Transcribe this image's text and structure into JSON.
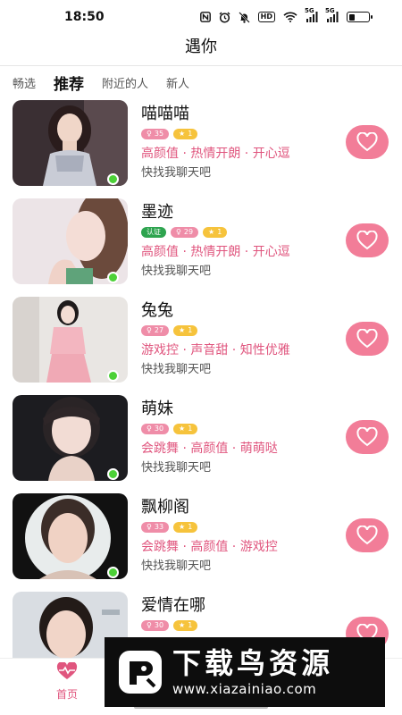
{
  "status_bar": {
    "time": "18:50",
    "icons": [
      "nfc-icon",
      "alarm-icon",
      "mute-icon",
      "hd-icon",
      "wifi-icon",
      "signal-5g-icon",
      "signal-5g-icon",
      "battery-icon"
    ],
    "hd_label": "HD",
    "sig1_label": "5G",
    "sig2_label": "5G"
  },
  "header": {
    "title": "遇你"
  },
  "tabs": [
    {
      "label": "畅选",
      "active": false
    },
    {
      "label": "推荐",
      "active": true
    },
    {
      "label": "附近的人",
      "active": false
    },
    {
      "label": "新人",
      "active": false
    }
  ],
  "users": [
    {
      "name": "喵喵喵",
      "verified": false,
      "age": "35",
      "level": "1",
      "tags": "高颜值 · 热情开朗 · 开心逗",
      "intro": "快找我聊天吧",
      "online": true
    },
    {
      "name": "墨迹",
      "verified": true,
      "verified_label": "认证",
      "age": "29",
      "level": "1",
      "tags": "高颜值 · 热情开朗 · 开心逗",
      "intro": "快找我聊天吧",
      "online": true
    },
    {
      "name": "兔兔",
      "verified": false,
      "age": "27",
      "level": "1",
      "tags": "游戏控 · 声音甜 · 知性优雅",
      "intro": "快找我聊天吧",
      "online": true
    },
    {
      "name": "萌妹",
      "verified": false,
      "age": "30",
      "level": "1",
      "tags": "会跳舞 · 高颜值 · 萌萌哒",
      "intro": "快找我聊天吧",
      "online": true
    },
    {
      "name": "飘柳阁",
      "verified": false,
      "age": "33",
      "level": "1",
      "tags": "会跳舞 · 高颜值 · 游戏控",
      "intro": "快找我聊天吧",
      "online": true
    },
    {
      "name": "爱情在哪",
      "verified": false,
      "age": "30",
      "level": "1",
      "tags": "",
      "intro": "",
      "online": false
    }
  ],
  "bottom_nav": {
    "home_label": "首页"
  },
  "watermark": {
    "title": "下载鸟资源",
    "url": "www.xiazainiao.com"
  },
  "colors": {
    "accent": "#f27d98",
    "tag_text": "#e0557e",
    "online": "#4cd137",
    "verified": "#2ea44f",
    "level": "#f6c33c"
  }
}
